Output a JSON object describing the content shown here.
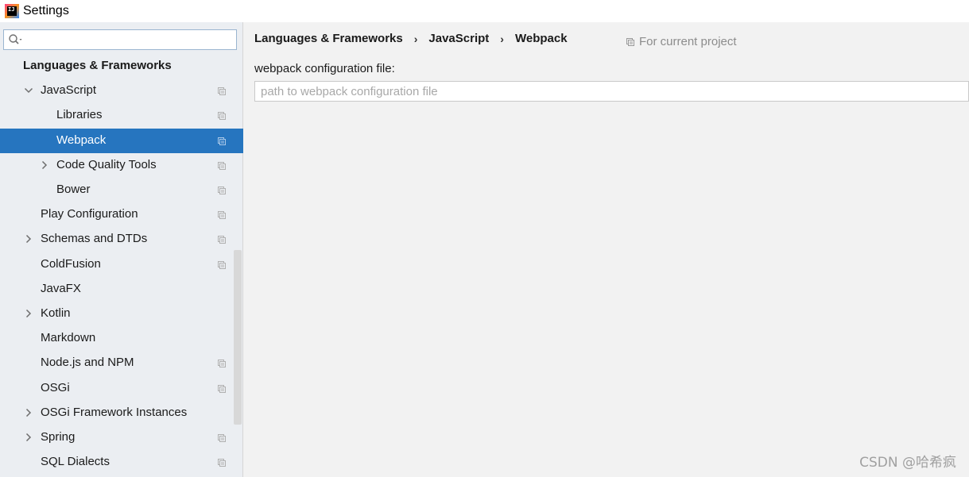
{
  "window": {
    "title": "Settings",
    "app_icon": "intellij-idea-icon"
  },
  "search": {
    "value": "",
    "placeholder": ""
  },
  "sidebar": {
    "items": [
      {
        "label": "Languages & Frameworks",
        "level": 0,
        "header": true
      },
      {
        "label": "JavaScript",
        "level": 1,
        "expanded": true,
        "project_scope": true
      },
      {
        "label": "Libraries",
        "level": 2,
        "project_scope": true
      },
      {
        "label": "Webpack",
        "level": 2,
        "selected": true,
        "project_scope": true
      },
      {
        "label": "Code Quality Tools",
        "level": 2,
        "collapsed": true,
        "project_scope": true
      },
      {
        "label": "Bower",
        "level": 2,
        "project_scope": true
      },
      {
        "label": "Play Configuration",
        "level": 1,
        "project_scope": true
      },
      {
        "label": "Schemas and DTDs",
        "level": 1,
        "collapsed": true,
        "project_scope": true
      },
      {
        "label": "ColdFusion",
        "level": 1,
        "project_scope": true
      },
      {
        "label": "JavaFX",
        "level": 1
      },
      {
        "label": "Kotlin",
        "level": 1,
        "collapsed": true
      },
      {
        "label": "Markdown",
        "level": 1
      },
      {
        "label": "Node.js and NPM",
        "level": 1,
        "project_scope": true
      },
      {
        "label": "OSGi",
        "level": 1,
        "project_scope": true
      },
      {
        "label": "OSGi Framework Instances",
        "level": 1,
        "collapsed": true
      },
      {
        "label": "Spring",
        "level": 1,
        "collapsed": true,
        "project_scope": true
      },
      {
        "label": "SQL Dialects",
        "level": 1,
        "project_scope": true
      }
    ]
  },
  "breadcrumb": {
    "items": [
      "Languages & Frameworks",
      "JavaScript",
      "Webpack"
    ],
    "separator": "›"
  },
  "scope_note": "For current project",
  "form": {
    "config_label": "webpack configuration file:",
    "config_value": "",
    "config_placeholder": "path to webpack configuration file"
  },
  "watermark": "CSDN @哈希疯",
  "colors": {
    "selection": "#2675bf",
    "sidebar_bg": "#ebeef2",
    "content_bg": "#f2f2f2"
  }
}
